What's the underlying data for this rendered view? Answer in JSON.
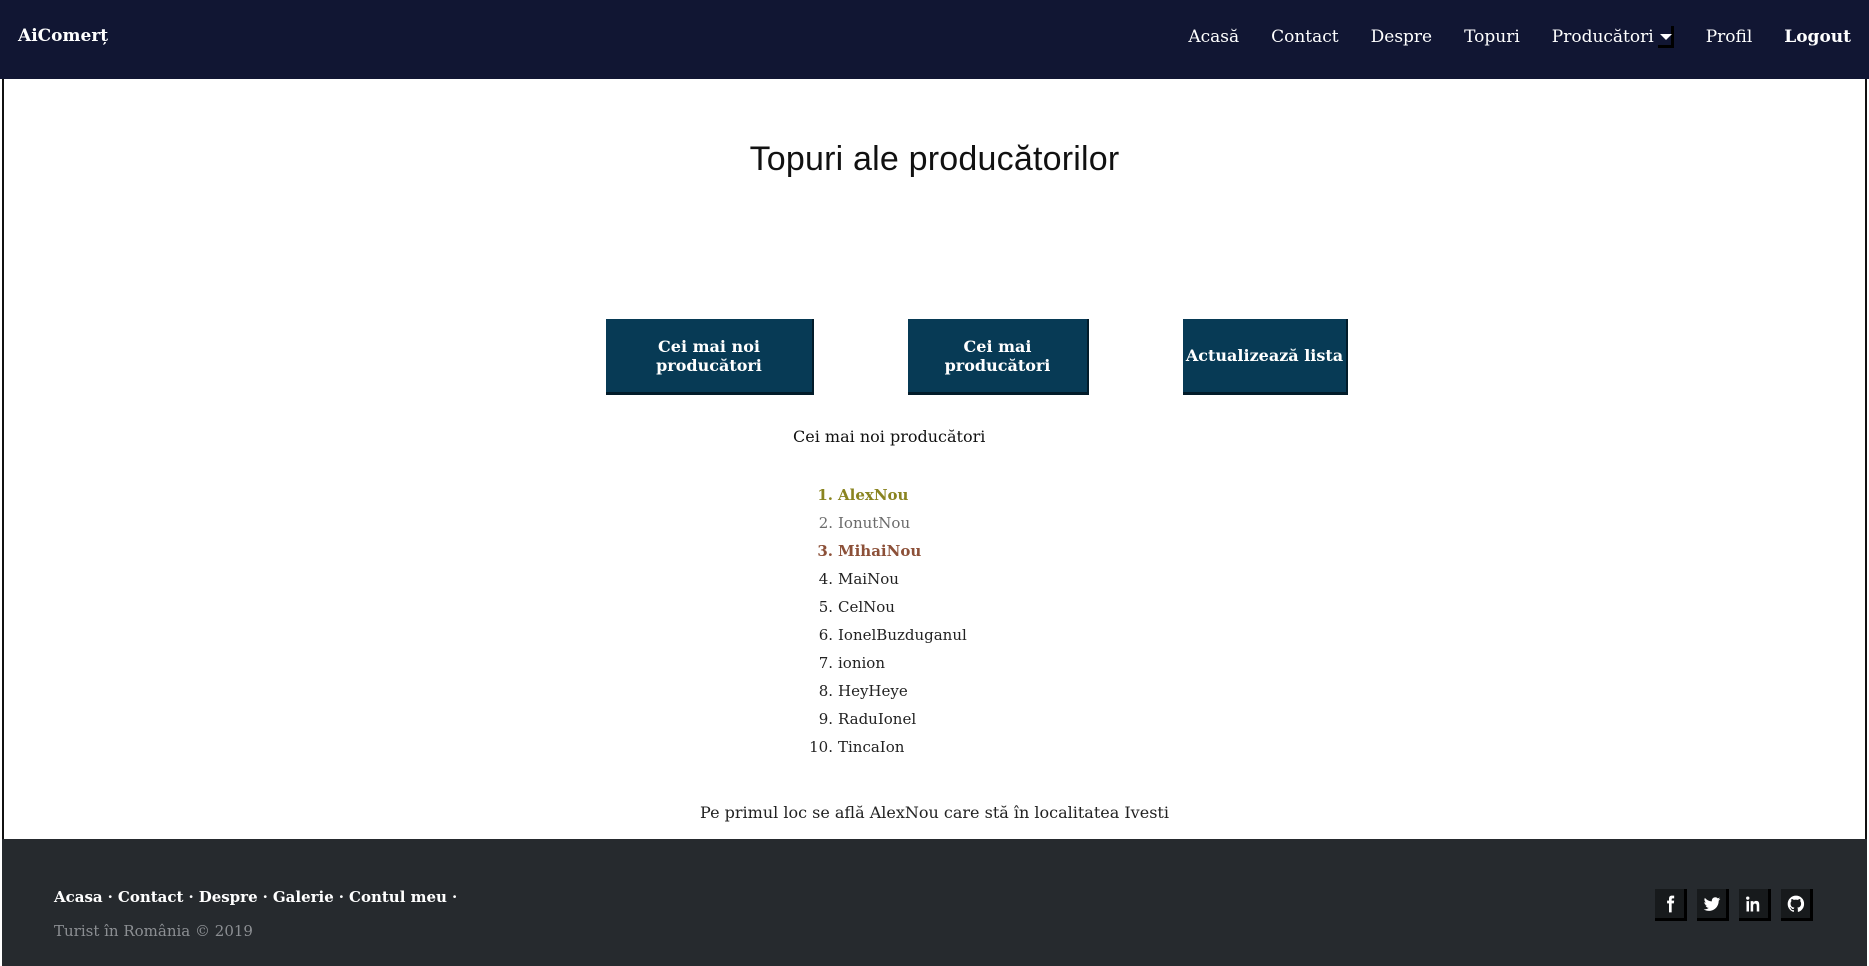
{
  "header": {
    "brand": "AiComerț",
    "nav": {
      "home": "Acasă",
      "contact": "Contact",
      "about": "Despre",
      "tops": "Topuri",
      "producers": "Producători",
      "profile": "Profil",
      "logout": "Logout"
    }
  },
  "main": {
    "title": "Topuri ale producătorilor",
    "buttons": {
      "newest": "Cei mai noi producători",
      "top": "Cei mai producători",
      "refresh": "Actualizează lista"
    },
    "list_title": "Cei mai noi producători",
    "ranking": [
      {
        "num": "1.",
        "name": "AlexNou"
      },
      {
        "num": "2.",
        "name": "IonutNou"
      },
      {
        "num": "3.",
        "name": "MihaiNou"
      },
      {
        "num": "4.",
        "name": "MaiNou"
      },
      {
        "num": "5.",
        "name": "CelNou"
      },
      {
        "num": "6.",
        "name": "IonelBuzduganul"
      },
      {
        "num": "7.",
        "name": "ionion"
      },
      {
        "num": "8.",
        "name": "HeyHeye"
      },
      {
        "num": "9.",
        "name": "RaduIonel"
      },
      {
        "num": "10.",
        "name": "TincaIon"
      }
    ],
    "first_place_text": "Pe primul loc se află AlexNou care stă în localitatea Ivesti"
  },
  "footer": {
    "links": [
      "Acasa",
      "Contact",
      "Despre",
      "Galerie",
      "Contul meu"
    ],
    "separator": "·",
    "copyright": "Turist în România © 2019",
    "social": [
      "facebook-icon",
      "twitter-icon",
      "linkedin-icon",
      "github-icon"
    ]
  },
  "colors": {
    "navbar": "#111633",
    "button": "#073a55",
    "footer": "#262a2e",
    "gold": "#8a8420",
    "silver": "#6b6b6b",
    "bronze": "#8c5038"
  }
}
